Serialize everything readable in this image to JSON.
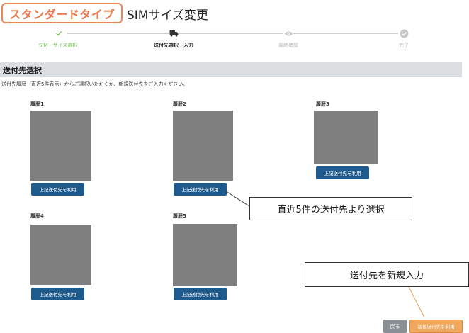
{
  "header": {
    "plan_badge": "スタンダードタイプ",
    "title": "SIMサイズ変更"
  },
  "steps": [
    {
      "label": "SIM・サイズ選択",
      "state": "done",
      "icon": "check-icon"
    },
    {
      "label": "送付先選択・入力",
      "state": "current",
      "icon": "truck-icon"
    },
    {
      "label": "最終確認",
      "state": "todo",
      "icon": "eye-icon"
    },
    {
      "label": "完了",
      "state": "todo",
      "icon": "check-circle-icon"
    }
  ],
  "section": {
    "title": "送付先選択",
    "description": "送付先履歴（直近5件表示）からご選択いただくか、新規送付先をご入力ください。"
  },
  "history": [
    {
      "label": "履歴1",
      "button": "上記送付先を利用"
    },
    {
      "label": "履歴2",
      "button": "上記送付先を利用"
    },
    {
      "label": "履歴3",
      "button": "上記送付先を利用"
    },
    {
      "label": "履歴4",
      "button": "上記送付先を利用"
    },
    {
      "label": "履歴5",
      "button": "上記送付先を利用"
    }
  ],
  "callouts": {
    "select_recent": "直近5件の送付先より選択",
    "new_input": "送付先を新規入力"
  },
  "footer": {
    "back_label": "戻る",
    "new_address_label": "新規送付先を利用"
  },
  "colors": {
    "accent_orange": "#e8784a",
    "step_done": "#6cbf4a",
    "primary_button": "#1f5a8c",
    "new_button": "#f0a85e",
    "back_button": "#8a8f95",
    "section_bar": "#dcdfe2"
  }
}
